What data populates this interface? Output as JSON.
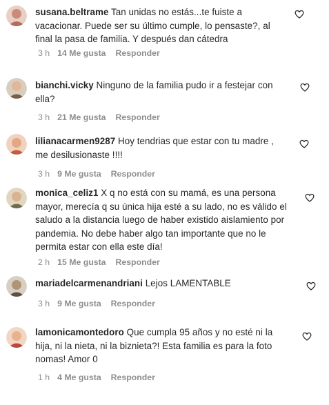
{
  "comments": [
    {
      "username": "susana.beltrame",
      "text": "Tan unidas no estás...te fuiste a vacacionar. Puede ser su último cumple, lo pensaste?, al final la pasa de familia. Y después dan cátedra",
      "time": "3 h",
      "likes": "14 Me gusta",
      "reply": "Responder",
      "avatar_color": "#c98c7a"
    },
    {
      "username": "bianchi.vicky",
      "text": "Ninguno de la familia pudo ir a festejar con ella?",
      "time": "3 h",
      "likes": "21 Me gusta",
      "reply": "Responder",
      "avatar_color": "#b59a83"
    },
    {
      "username": "lilianacarmen9287",
      "text": "Hoy tendrias que estar con tu madre , me desilusionaste !!!!",
      "time": "3 h",
      "likes": "9 Me gusta",
      "reply": "Responder",
      "avatar_color": "#d07c62"
    },
    {
      "username": "monica_celiz1",
      "text": "X q no está con su mamá, es una persona mayor, merecía q su única hija esté a su lado, no es válido el saludo a la distancia luego de haber existido aislamiento por pandemia. No debe haber algo tan importante que no le permita estar con ella este día!",
      "time": "2 h",
      "likes": "15 Me gusta",
      "reply": "Responder",
      "avatar_color": "#9a8a6a"
    },
    {
      "username": "mariadelcarmenandriani",
      "text": "Lejos LAMENTABLE",
      "time": "3 h",
      "likes": "9 Me gusta",
      "reply": "Responder",
      "avatar_color": "#8c7b6a"
    },
    {
      "username": "lamonicamontedoro",
      "text": "Que cumpla 95 años y no esté ni la hija, ni la nieta, ni la biznieta?! Esta familia es para la foto nomas! Amor 0",
      "time": "1 h",
      "likes": "4 Me gusta",
      "reply": "Responder",
      "avatar_color": "#c9725a"
    }
  ],
  "icons": {
    "like": "heart-outline-icon"
  }
}
